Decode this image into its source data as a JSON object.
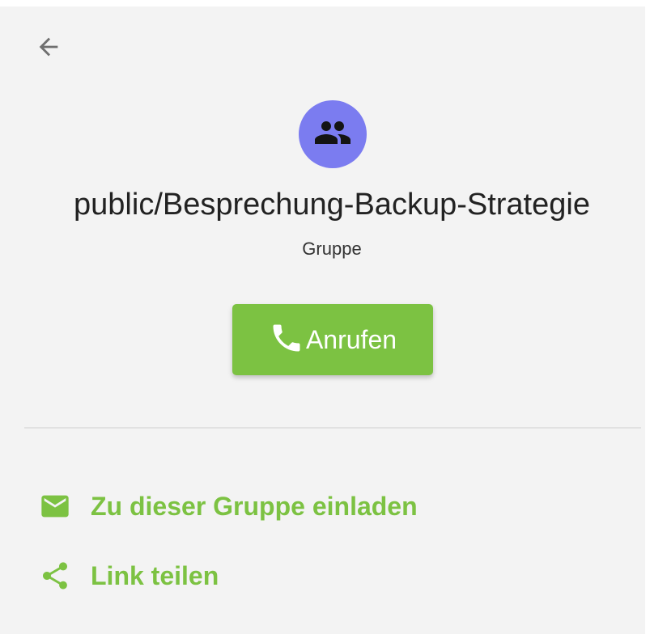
{
  "header": {
    "back_icon": "arrow-back-icon"
  },
  "room": {
    "avatar_icon": "group-icon",
    "name": "public/Besprechung-Backup-Strategie",
    "type": "Gruppe"
  },
  "call": {
    "icon": "phone-icon",
    "label": "Anrufen"
  },
  "actions": [
    {
      "icon": "email-icon",
      "label": "Zu dieser Gruppe einladen"
    },
    {
      "icon": "share-icon",
      "label": "Link teilen"
    }
  ],
  "colors": {
    "background": "#f3f3f3",
    "accent": "#7cc242",
    "avatar": "#7b7cf0",
    "back_icon": "#6f6f6f",
    "divider": "#e1e1e1"
  }
}
